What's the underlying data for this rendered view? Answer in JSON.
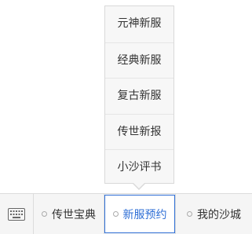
{
  "popup_menu": {
    "items": [
      {
        "label": "元神新服"
      },
      {
        "label": "经典新服"
      },
      {
        "label": "复古新服"
      },
      {
        "label": "传世新报"
      },
      {
        "label": "小沙评书"
      }
    ]
  },
  "bottom_bar": {
    "keyboard_icon": "keyboard-icon",
    "tabs": [
      {
        "label": "传世宝典"
      },
      {
        "label": "新服预约",
        "active": true
      },
      {
        "label": "我的沙城"
      }
    ]
  },
  "colors": {
    "accent": "#2f6fd6",
    "bar_background": "#f5f5f5",
    "popup_background": "#f7f7f7"
  }
}
